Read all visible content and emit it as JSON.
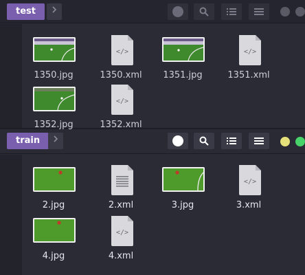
{
  "panes": [
    {
      "folder": "test",
      "files": [
        {
          "name": "1350.jpg",
          "kind": "image"
        },
        {
          "name": "1350.xml",
          "kind": "xml"
        },
        {
          "name": "1351.jpg",
          "kind": "image"
        },
        {
          "name": "1351.xml",
          "kind": "xml"
        },
        {
          "name": "1352.jpg",
          "kind": "image"
        },
        {
          "name": "1352.xml",
          "kind": "xml"
        }
      ]
    },
    {
      "folder": "train",
      "files": [
        {
          "name": "2.jpg",
          "kind": "image"
        },
        {
          "name": "2.xml",
          "kind": "text-document"
        },
        {
          "name": "3.jpg",
          "kind": "image"
        },
        {
          "name": "3.xml",
          "kind": "xml"
        },
        {
          "name": "4.jpg",
          "kind": "image"
        },
        {
          "name": "4.xml",
          "kind": "xml"
        }
      ]
    }
  ],
  "toolbar_icons": [
    "circle-icon",
    "search-icon",
    "list-view-icon",
    "hamburger-menu-icon"
  ],
  "window_dot_colors": {
    "top": [
      "#5a5a66",
      "#5a5a66"
    ],
    "bottom": [
      "#e6e07a",
      "#48d36a"
    ]
  },
  "accent_color": "#7a5fae"
}
